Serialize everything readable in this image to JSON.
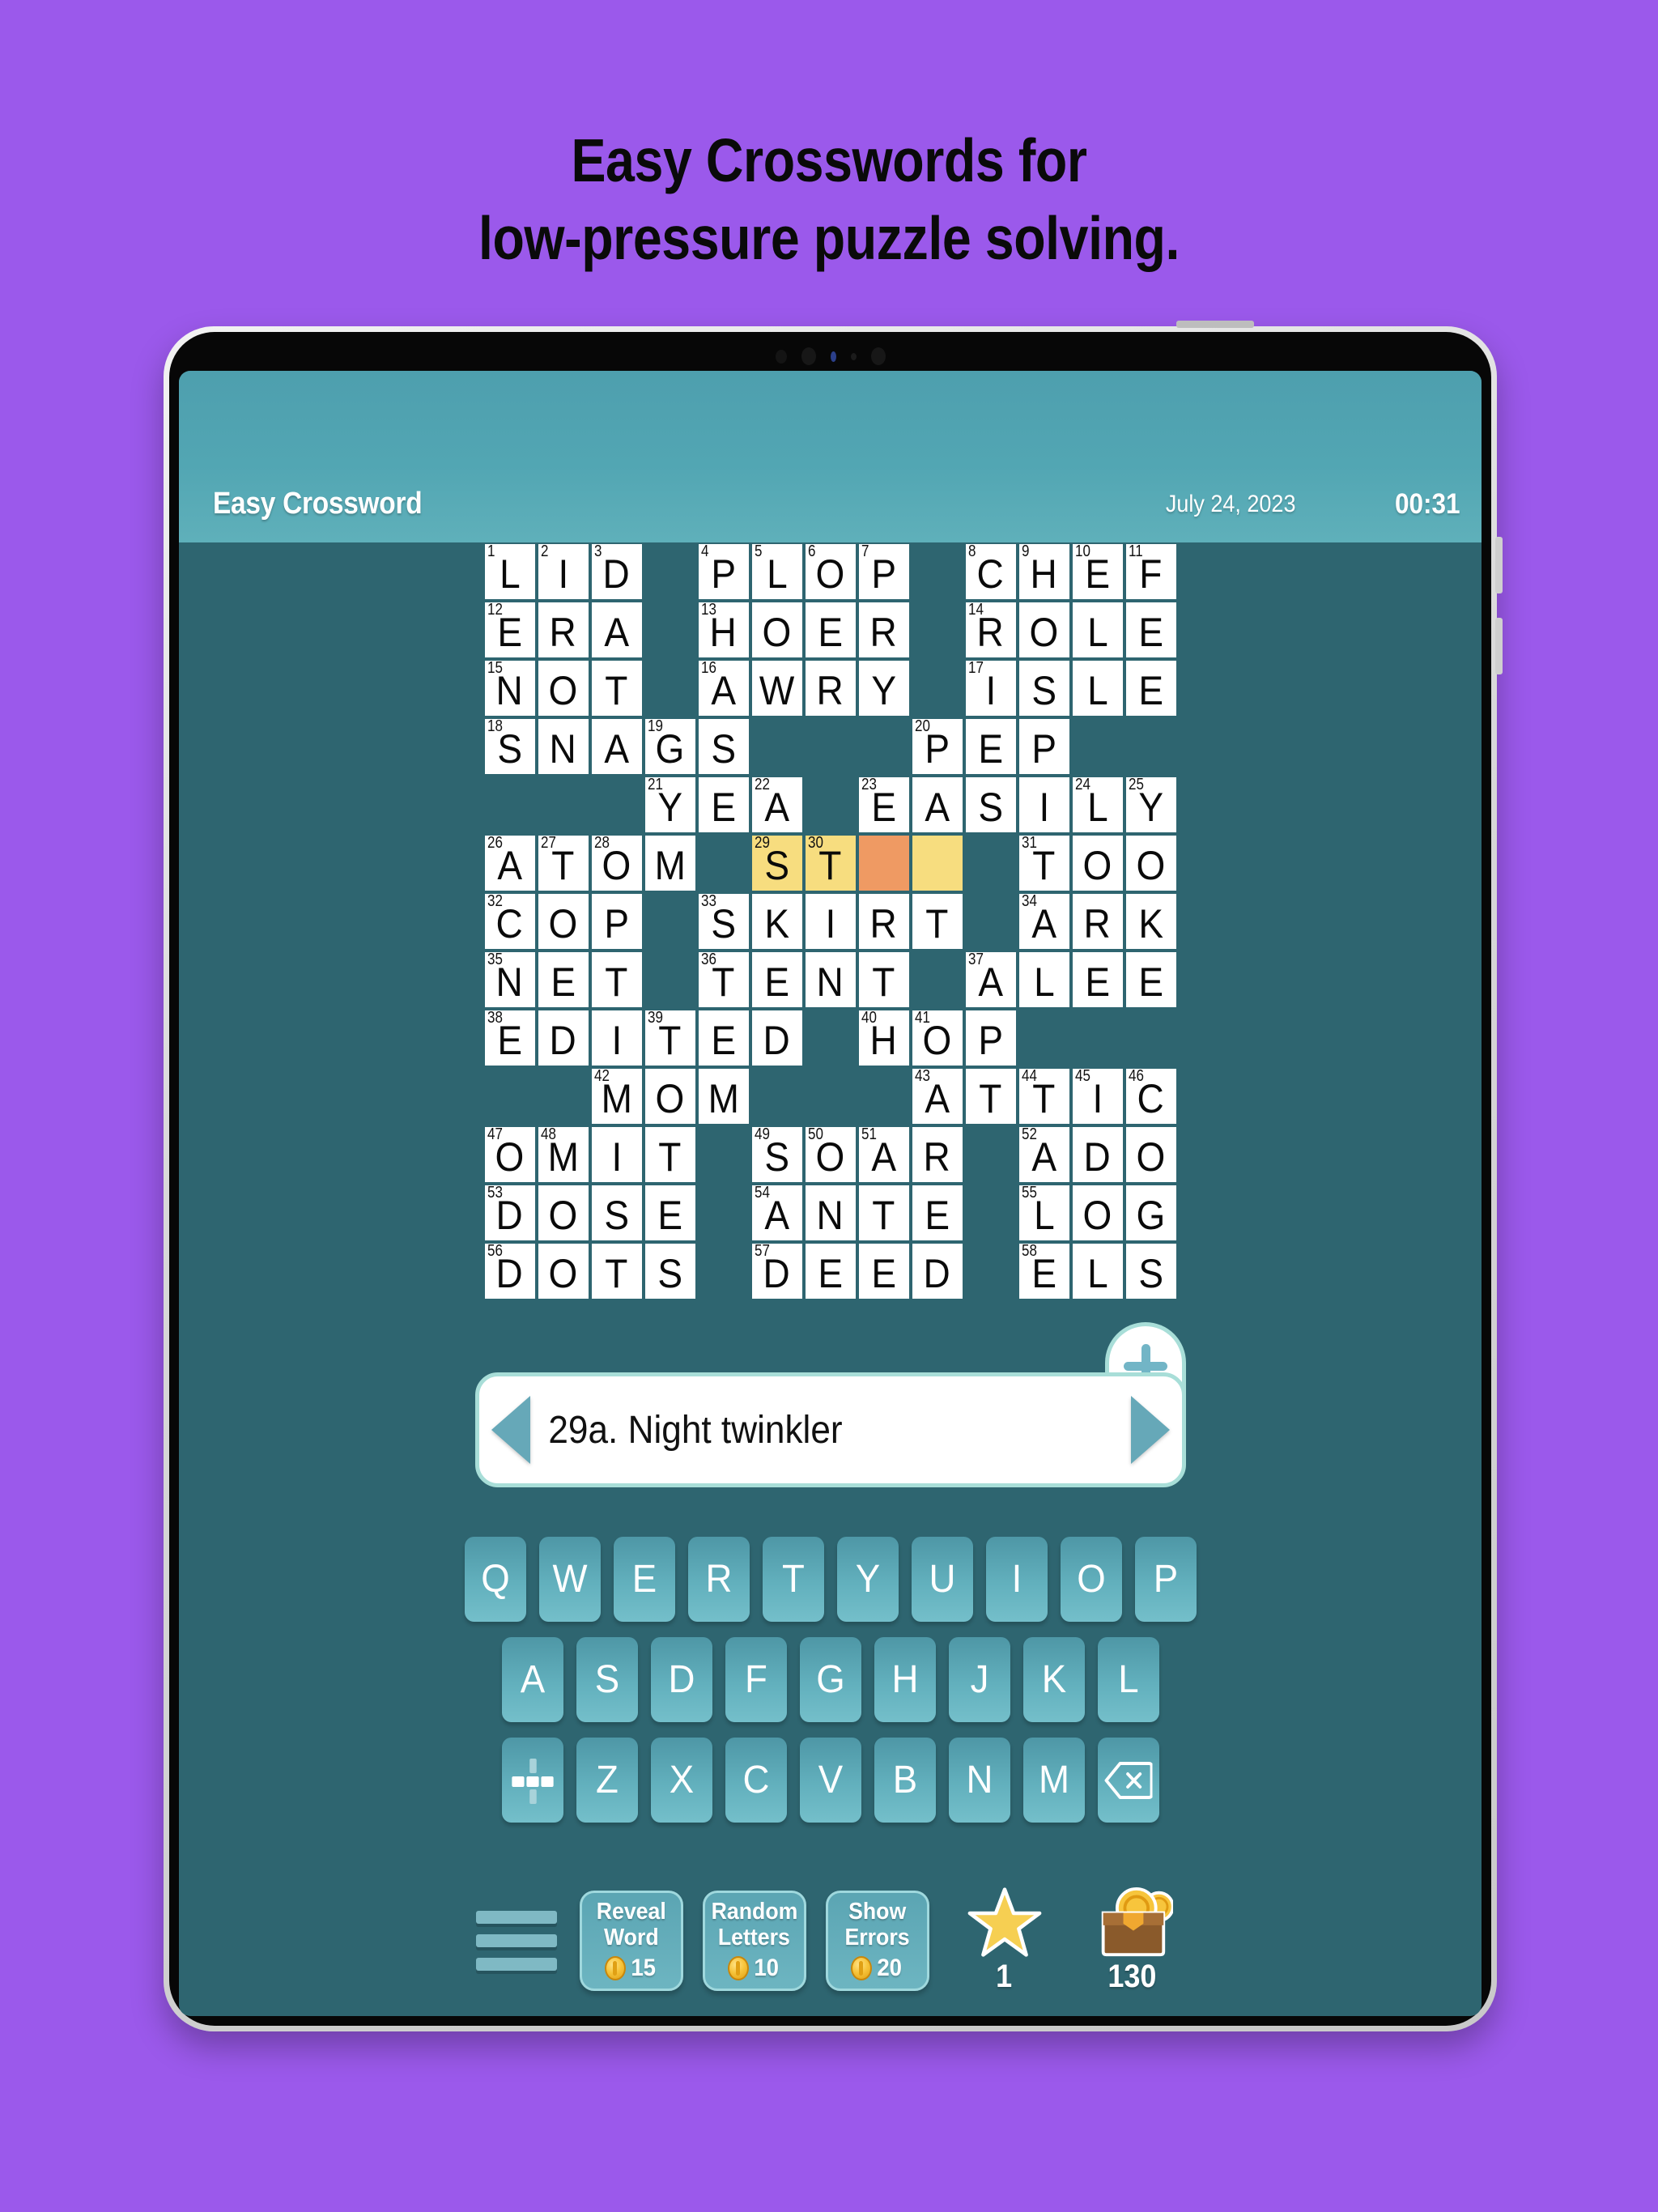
{
  "headline": {
    "line1": "Easy Crosswords for",
    "line2": "low-pressure puzzle solving."
  },
  "colors": {
    "background": "#9b59eb",
    "app_header": "#52a6b3",
    "app_body": "#2e6570",
    "cell_highlight": "#f7dd7f",
    "cell_cursor": "#ef9a63",
    "key": "#62b0bd",
    "coin_gold": "#f7c53c",
    "star_gold": "#f6cf52"
  },
  "header": {
    "title": "Easy Crossword",
    "date": "July 24, 2023",
    "timer": "00:31"
  },
  "crossword": {
    "columns": 13,
    "rows": 14,
    "rows_data": [
      {
        "index": 0,
        "cells": [
          {
            "n": "1",
            "l": "L"
          },
          {
            "n": "2",
            "l": "I"
          },
          {
            "n": "3",
            "l": "D"
          },
          null,
          {
            "n": "4",
            "l": "P"
          },
          {
            "n": "5",
            "l": "L"
          },
          {
            "n": "6",
            "l": "O"
          },
          {
            "n": "7",
            "l": "P"
          },
          null,
          {
            "n": "8",
            "l": "C"
          },
          {
            "n": "9",
            "l": "H"
          },
          {
            "n": "10",
            "l": "E"
          },
          {
            "n": "11",
            "l": "F"
          }
        ]
      },
      {
        "index": 1,
        "cells": [
          {
            "n": "12",
            "l": "E"
          },
          {
            "n": "",
            "l": "R"
          },
          {
            "n": "",
            "l": "A"
          },
          null,
          {
            "n": "13",
            "l": "H"
          },
          {
            "n": "",
            "l": "O"
          },
          {
            "n": "",
            "l": "E"
          },
          {
            "n": "",
            "l": "R"
          },
          null,
          {
            "n": "14",
            "l": "R"
          },
          {
            "n": "",
            "l": "O"
          },
          {
            "n": "",
            "l": "L"
          },
          {
            "n": "",
            "l": "E"
          }
        ]
      },
      {
        "index": 2,
        "cells": [
          {
            "n": "15",
            "l": "N"
          },
          {
            "n": "",
            "l": "O"
          },
          {
            "n": "",
            "l": "T"
          },
          null,
          {
            "n": "16",
            "l": "A"
          },
          {
            "n": "",
            "l": "W"
          },
          {
            "n": "",
            "l": "R"
          },
          {
            "n": "",
            "l": "Y"
          },
          null,
          {
            "n": "17",
            "l": "I"
          },
          {
            "n": "",
            "l": "S"
          },
          {
            "n": "",
            "l": "L"
          },
          {
            "n": "",
            "l": "E"
          }
        ]
      },
      {
        "index": 3,
        "cells": [
          {
            "n": "18",
            "l": "S"
          },
          {
            "n": "",
            "l": "N"
          },
          {
            "n": "",
            "l": "A"
          },
          {
            "n": "19",
            "l": "G"
          },
          {
            "n": "",
            "l": "S"
          },
          null,
          null,
          null,
          {
            "n": "20",
            "l": "P"
          },
          {
            "n": "",
            "l": "E"
          },
          {
            "n": "",
            "l": "P"
          },
          null,
          null
        ]
      },
      {
        "index": 4,
        "cells": [
          null,
          null,
          null,
          {
            "n": "21",
            "l": "Y"
          },
          {
            "n": "",
            "l": "E"
          },
          {
            "n": "22",
            "l": "A"
          },
          null,
          {
            "n": "23",
            "l": "E"
          },
          {
            "n": "",
            "l": "A"
          },
          {
            "n": "",
            "l": "S"
          },
          {
            "n": "",
            "l": "I"
          },
          {
            "n": "24",
            "l": "L"
          },
          {
            "n": "25",
            "l": "Y"
          }
        ]
      },
      {
        "index": 5,
        "cells": [
          {
            "n": "26",
            "l": "A"
          },
          {
            "n": "27",
            "l": "T"
          },
          {
            "n": "28",
            "l": "O"
          },
          {
            "n": "",
            "l": "M"
          },
          null,
          {
            "n": "29",
            "l": "S",
            "state": "hl"
          },
          {
            "n": "30",
            "l": "T",
            "state": "hl"
          },
          {
            "n": "",
            "l": "",
            "state": "cursor"
          },
          {
            "n": "",
            "l": "",
            "state": "hl"
          },
          null,
          {
            "n": "31",
            "l": "T"
          },
          {
            "n": "",
            "l": "O"
          },
          {
            "n": "",
            "l": "O"
          }
        ]
      },
      {
        "index": 6,
        "cells": [
          {
            "n": "32",
            "l": "C"
          },
          {
            "n": "",
            "l": "O"
          },
          {
            "n": "",
            "l": "P"
          },
          null,
          {
            "n": "33",
            "l": "S"
          },
          {
            "n": "",
            "l": "K"
          },
          {
            "n": "",
            "l": "I"
          },
          {
            "n": "",
            "l": "R"
          },
          {
            "n": "",
            "l": "T"
          },
          null,
          {
            "n": "34",
            "l": "A"
          },
          {
            "n": "",
            "l": "R"
          },
          {
            "n": "",
            "l": "K"
          }
        ]
      },
      {
        "index": 7,
        "cells": [
          {
            "n": "35",
            "l": "N"
          },
          {
            "n": "",
            "l": "E"
          },
          {
            "n": "",
            "l": "T"
          },
          null,
          {
            "n": "36",
            "l": "T"
          },
          {
            "n": "",
            "l": "E"
          },
          {
            "n": "",
            "l": "N"
          },
          {
            "n": "",
            "l": "T"
          },
          null,
          {
            "n": "37",
            "l": "A"
          },
          {
            "n": "",
            "l": "L"
          },
          {
            "n": "",
            "l": "E"
          },
          {
            "n": "",
            "l": "E"
          }
        ]
      },
      {
        "index": 8,
        "cells": [
          {
            "n": "38",
            "l": "E"
          },
          {
            "n": "",
            "l": "D"
          },
          {
            "n": "",
            "l": "I"
          },
          {
            "n": "39",
            "l": "T"
          },
          {
            "n": "",
            "l": "E"
          },
          {
            "n": "",
            "l": "D"
          },
          null,
          {
            "n": "40",
            "l": "H"
          },
          {
            "n": "41",
            "l": "O"
          },
          {
            "n": "",
            "l": "P"
          },
          null,
          null,
          null
        ]
      },
      {
        "index": 9,
        "cells": [
          null,
          null,
          {
            "n": "42",
            "l": "M"
          },
          {
            "n": "",
            "l": "O"
          },
          {
            "n": "",
            "l": "M"
          },
          null,
          null,
          null,
          {
            "n": "43",
            "l": "A"
          },
          {
            "n": "",
            "l": "T"
          },
          {
            "n": "44",
            "l": "T"
          },
          {
            "n": "45",
            "l": "I"
          },
          {
            "n": "46",
            "l": "C"
          }
        ]
      },
      {
        "index": 10,
        "cells": [
          {
            "n": "47",
            "l": "O"
          },
          {
            "n": "48",
            "l": "M"
          },
          {
            "n": "",
            "l": "I"
          },
          {
            "n": "",
            "l": "T"
          },
          null,
          {
            "n": "49",
            "l": "S"
          },
          {
            "n": "50",
            "l": "O"
          },
          {
            "n": "51",
            "l": "A"
          },
          {
            "n": "",
            "l": "R"
          },
          null,
          {
            "n": "52",
            "l": "A"
          },
          {
            "n": "",
            "l": "D"
          },
          {
            "n": "",
            "l": "O"
          }
        ]
      },
      {
        "index": 11,
        "cells": [
          {
            "n": "53",
            "l": "D"
          },
          {
            "n": "",
            "l": "O"
          },
          {
            "n": "",
            "l": "S"
          },
          {
            "n": "",
            "l": "E"
          },
          null,
          {
            "n": "54",
            "l": "A"
          },
          {
            "n": "",
            "l": "N"
          },
          {
            "n": "",
            "l": "T"
          },
          {
            "n": "",
            "l": "E"
          },
          null,
          {
            "n": "55",
            "l": "L"
          },
          {
            "n": "",
            "l": "O"
          },
          {
            "n": "",
            "l": "G"
          }
        ]
      },
      {
        "index": 12,
        "cells": [
          {
            "n": "56",
            "l": "D"
          },
          {
            "n": "",
            "l": "O"
          },
          {
            "n": "",
            "l": "T"
          },
          {
            "n": "",
            "l": "S"
          },
          null,
          {
            "n": "57",
            "l": "D"
          },
          {
            "n": "",
            "l": "E"
          },
          {
            "n": "",
            "l": "E"
          },
          {
            "n": "",
            "l": "D"
          },
          null,
          {
            "n": "58",
            "l": "E"
          },
          {
            "n": "",
            "l": "L"
          },
          {
            "n": "",
            "l": "S"
          }
        ]
      }
    ]
  },
  "clue": {
    "text": "29a. Night twinkler",
    "prev_icon": "triangle-left-icon",
    "next_icon": "triangle-right-icon",
    "add_icon": "plus-icon"
  },
  "keyboard": {
    "row1": [
      "Q",
      "W",
      "E",
      "R",
      "T",
      "Y",
      "U",
      "I",
      "O",
      "P"
    ],
    "row2": [
      "A",
      "S",
      "D",
      "F",
      "G",
      "H",
      "J",
      "K",
      "L"
    ],
    "row3_prefix_icon": "direction-toggle-icon",
    "row3": [
      "Z",
      "X",
      "C",
      "V",
      "B",
      "N",
      "M"
    ],
    "row3_suffix_icon": "backspace-icon"
  },
  "toolbar": {
    "menu_icon": "hamburger-menu-icon",
    "hints": [
      {
        "l1": "Reveal",
        "l2": "Word",
        "cost": "15"
      },
      {
        "l1": "Random",
        "l2": "Letters",
        "cost": "10"
      },
      {
        "l1": "Show",
        "l2": "Errors",
        "cost": "20"
      }
    ],
    "stars": {
      "icon": "star-icon",
      "value": "1"
    },
    "coins": {
      "icon": "coin-chest-icon",
      "value": "130"
    }
  }
}
